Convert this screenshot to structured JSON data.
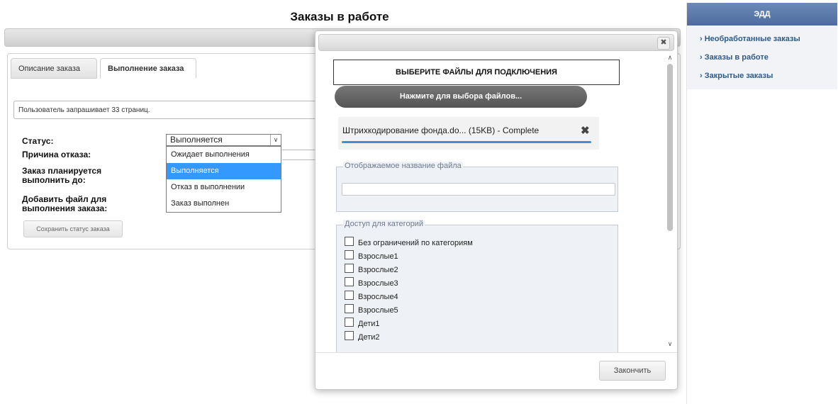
{
  "page": {
    "title": "Заказы в работе"
  },
  "tabs": [
    {
      "label": "Описание заказа"
    },
    {
      "label": "Выполнение заказа"
    }
  ],
  "form": {
    "description_value": "Пользователь запрашивает 33 страниц.",
    "status_label": "Статус:",
    "reason_label": "Причина отказа:",
    "planned_label": "Заказ планируется выполнить до:",
    "add_file_label": "Добавить файл для выполнения заказа:",
    "status_selected": "Выполняется",
    "status_options": [
      "Ожидает выполнения",
      "Выполняется",
      "Отказ в выполнении",
      "Заказ выполнен"
    ],
    "save_button": "Сохранить статус заказа"
  },
  "sidebar": {
    "header": "ЭДД",
    "items": [
      {
        "label": "Необработанные заказы"
      },
      {
        "label": "Заказы в работе"
      },
      {
        "label": "Закрытые заказы"
      }
    ]
  },
  "dialog": {
    "choose_title": "ВЫБЕРИТЕ ФАЙЛЫ ДЛЯ ПОДКЛЮЧЕНИЯ",
    "pick_button": "Нажмите для выбора файлов...",
    "file": {
      "name": "Штрихкодирование фонда.do... (15KB) - Complete",
      "progress": 1.0
    },
    "display_name_legend": "Отображаемое название файла",
    "display_name_value": "",
    "access_legend": "Доступ для категорий",
    "categories": [
      "Без ограничений по категориям",
      "Взрослые1",
      "Взрослые2",
      "Взрослые3",
      "Взрослые4",
      "Взрослые5",
      "Дети1",
      "Дети2"
    ],
    "finish_button": "Закончить"
  },
  "colors": {
    "sidebar_header": "#4e6d9e",
    "sidebar_link": "#2e5a8b",
    "selected_option": "#3399ff",
    "progress_bar": "#3f8ddc"
  }
}
